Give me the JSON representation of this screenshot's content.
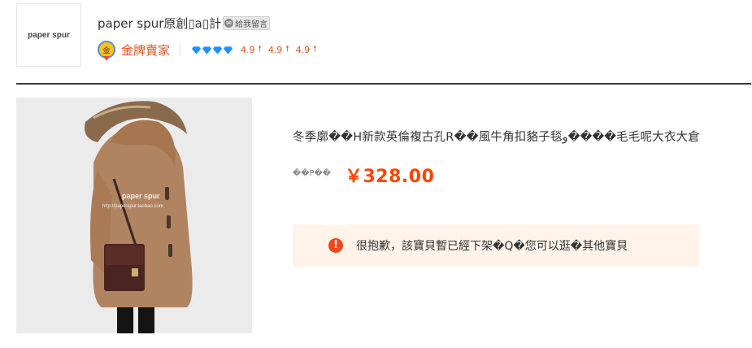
{
  "shop": {
    "logo_text": "paper spur",
    "name": "paper spur原創▯a▯計",
    "message_button": "給我留言",
    "seller_level": "金牌賣家",
    "medal_text": "金",
    "scores": [
      "4.9",
      "4.9",
      "4.9"
    ],
    "diamond_count": 4,
    "diamond_color": "#1e90ff"
  },
  "product": {
    "title": "冬季廓��H新款英倫複古孔R��風牛角扣貉子毯و����毛毛呢大衣大倉",
    "price_label": "��P��",
    "price": "￥328.00",
    "photo_watermark": "paper spur",
    "photo_watermark_url": "http://paperspur.taobao.com"
  },
  "notice": {
    "message": "很抱歉，該寶貝暫已經下架�Q�您可以逛�其他寶貝",
    "icon": "!"
  },
  "colors": {
    "accent": "#ff4400",
    "notice_bg": "#fff3ea",
    "alert_icon": "#f2471c"
  }
}
